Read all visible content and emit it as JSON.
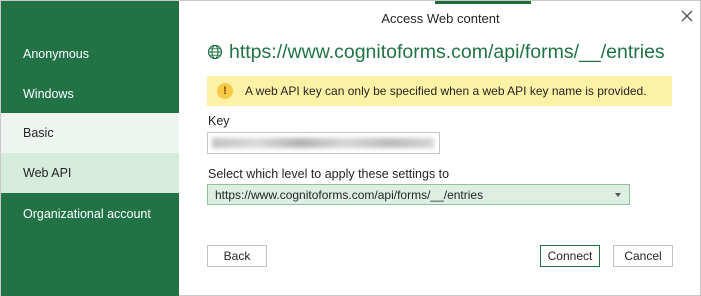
{
  "dialog": {
    "title": "Access Web content",
    "close_icon": "close-icon",
    "accent_color": "#217346"
  },
  "sidebar": {
    "items": [
      {
        "label": "Anonymous"
      },
      {
        "label": "Windows"
      },
      {
        "label": "Basic"
      },
      {
        "label": "Web API",
        "selected": true
      },
      {
        "label": "Organizational account"
      }
    ]
  },
  "main": {
    "url_icon": "globe-icon",
    "url": "https://www.cognitoforms.com/api/forms/__/entries",
    "warning": {
      "icon": "warning-icon",
      "text": "A web API key can only be specified when a web API key name is provided."
    },
    "key": {
      "label": "Key"
    },
    "level": {
      "label": "Select which level to apply these settings to",
      "selected": "https://www.cognitoforms.com/api/forms/__/entries"
    }
  },
  "buttons": {
    "back": "Back",
    "connect": "Connect",
    "cancel": "Cancel"
  }
}
